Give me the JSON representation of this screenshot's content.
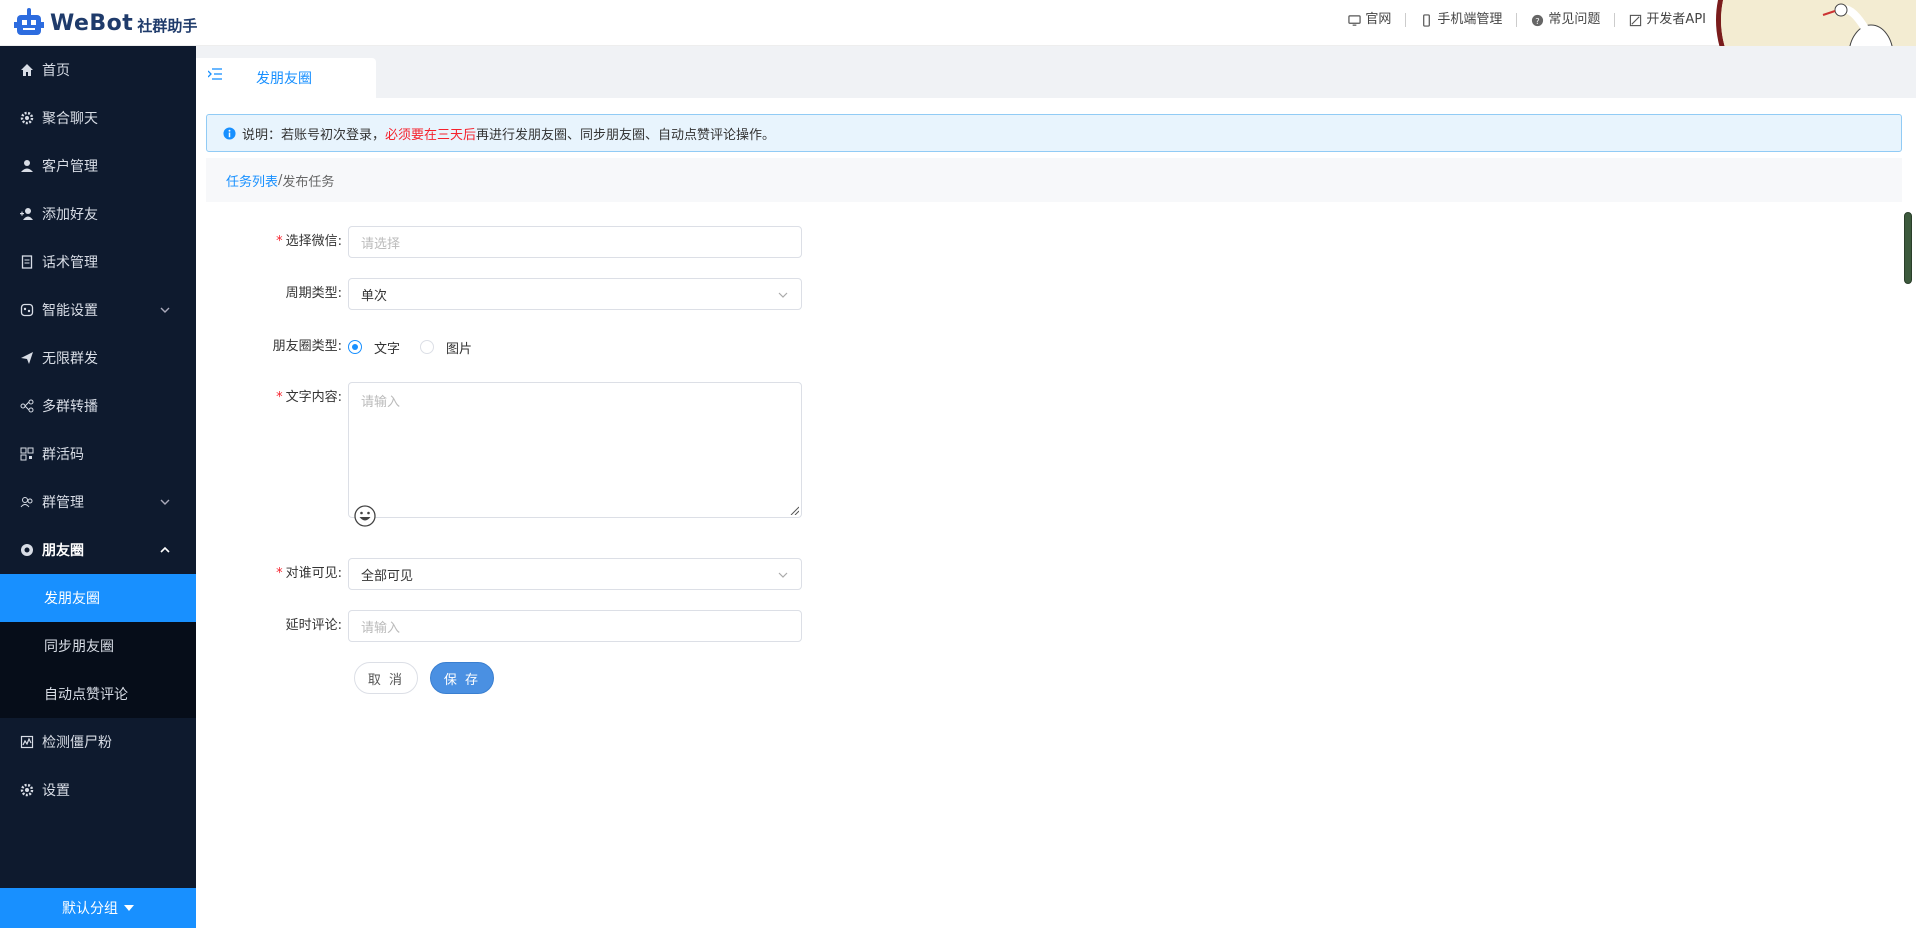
{
  "header": {
    "logo_text": "WeBot",
    "logo_sub": "社群助手",
    "links": [
      {
        "label": "官网",
        "icon": "monitor-icon"
      },
      {
        "label": "手机端管理",
        "icon": "phone-icon"
      },
      {
        "label": "常见问题",
        "icon": "question-icon"
      },
      {
        "label": "开发者API",
        "icon": "api-icon"
      }
    ]
  },
  "sidebar": {
    "items": [
      {
        "label": "首页",
        "icon": "home-icon"
      },
      {
        "label": "聚合聊天",
        "icon": "gear-icon"
      },
      {
        "label": "客户管理",
        "icon": "user-icon"
      },
      {
        "label": "添加好友",
        "icon": "add-user-icon"
      },
      {
        "label": "话术管理",
        "icon": "document-icon"
      },
      {
        "label": "智能设置",
        "icon": "brain-icon"
      },
      {
        "label": "无限群发",
        "icon": "send-icon"
      },
      {
        "label": "多群转播",
        "icon": "share-icon"
      },
      {
        "label": "群活码",
        "icon": "qrcode-icon"
      },
      {
        "label": "群管理",
        "icon": "group-icon"
      },
      {
        "label": "朋友圈",
        "icon": "moments-icon"
      }
    ],
    "submenu": [
      "发朋友圈",
      "同步朋友圈",
      "自动点赞评论"
    ],
    "bottom_items": [
      {
        "label": "检测僵尸粉",
        "icon": "chart-icon"
      },
      {
        "label": "设置",
        "icon": "settings-icon"
      }
    ],
    "group_button": "默认分组"
  },
  "tab": {
    "label": "发朋友圈"
  },
  "notice": {
    "prefix": "说明：若账号初次登录，",
    "highlight": "必须要在三天后",
    "suffix": "再进行发朋友圈、同步朋友圈、自动点赞评论操作。"
  },
  "breadcrumb": {
    "link": "任务列表",
    "separator": " / ",
    "current": "发布任务"
  },
  "form": {
    "wechat": {
      "label": "选择微信:",
      "placeholder": "请选择"
    },
    "cycle": {
      "label": "周期类型:",
      "value": "单次"
    },
    "moment_type": {
      "label": "朋友圈类型:",
      "options": [
        "文字",
        "图片"
      ],
      "selected": "文字"
    },
    "content": {
      "label": "文字内容:",
      "placeholder": "请输入"
    },
    "visibility": {
      "label": "对谁可见:",
      "value": "全部可见"
    },
    "delay": {
      "label": "延时评论:",
      "placeholder": "请输入"
    },
    "cancel_label": "取 消",
    "save_label": "保 存"
  },
  "colors": {
    "primary": "#1890ff",
    "sidebar_bg": "#0e1a2e",
    "required": "#f5222d"
  }
}
